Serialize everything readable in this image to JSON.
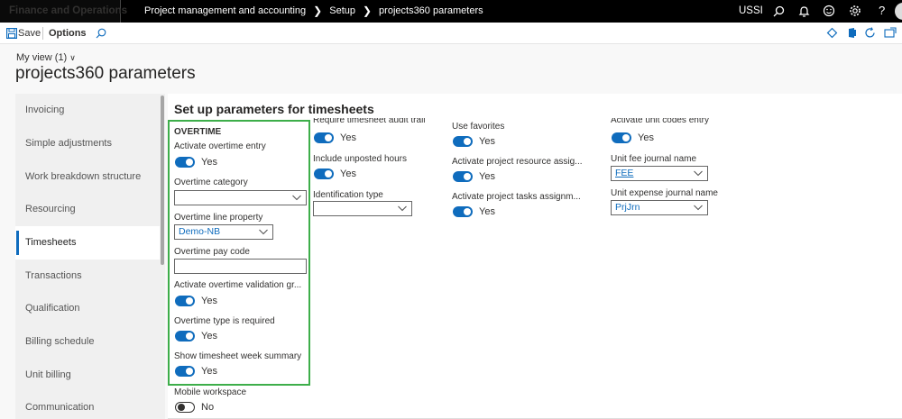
{
  "topnav": {
    "app_title": "Finance and Operations",
    "breadcrumb": [
      "Project management and accounting",
      "Setup",
      "projects360 parameters"
    ],
    "company": "USSI"
  },
  "actionbar": {
    "save_label": "Save",
    "options_label": "Options"
  },
  "header": {
    "my_view": "My view (1)",
    "page_title": "projects360 parameters"
  },
  "sidebar": {
    "items": [
      {
        "label": "Invoicing"
      },
      {
        "label": "Simple adjustments"
      },
      {
        "label": "Work breakdown structure"
      },
      {
        "label": "Resourcing"
      },
      {
        "label": "Timesheets"
      },
      {
        "label": "Transactions"
      },
      {
        "label": "Qualification"
      },
      {
        "label": "Billing schedule"
      },
      {
        "label": "Unit billing"
      },
      {
        "label": "Communication"
      }
    ],
    "active": "Timesheets"
  },
  "main": {
    "section_title": "Set up parameters for timesheets",
    "overtime": {
      "group_label": "OVERTIME",
      "activate_overtime_entry": {
        "label": "Activate overtime entry",
        "value": "Yes"
      },
      "overtime_category": {
        "label": "Overtime category",
        "value": ""
      },
      "overtime_line_property": {
        "label": "Overtime line property",
        "value": "Demo-NB"
      },
      "overtime_pay_code": {
        "label": "Overtime pay code",
        "value": ""
      },
      "activate_validation_group": {
        "label": "Activate overtime validation gr...",
        "value": "Yes"
      },
      "overtime_type_required": {
        "label": "Overtime type is required",
        "value": "Yes"
      },
      "show_week_summary": {
        "label": "Show timesheet week summary",
        "value": "Yes"
      }
    },
    "mobile_workspace": {
      "label": "Mobile workspace",
      "value": "No"
    },
    "col2": {
      "require_audit_trail": {
        "label": "Require timesheet audit trail",
        "value": "Yes"
      },
      "include_unposted_hours": {
        "label": "Include unposted hours",
        "value": "Yes"
      },
      "identification_type": {
        "label": "Identification type",
        "value": ""
      }
    },
    "col3": {
      "use_favorites": {
        "label": "Use favorites",
        "value": "Yes"
      },
      "activate_resource_assignment": {
        "label": "Activate project resource assig...",
        "value": "Yes"
      },
      "activate_tasks_assignment": {
        "label": "Activate project tasks assignm...",
        "value": "Yes"
      }
    },
    "col4": {
      "activate_unit_codes": {
        "label": "Activate unit codes entry",
        "value": "Yes"
      },
      "unit_fee_journal": {
        "label": "Unit fee journal name",
        "value": "FEE"
      },
      "unit_expense_journal": {
        "label": "Unit expense journal name",
        "value": "PrjJrn"
      }
    }
  },
  "colors": {
    "accent": "#0f6cbd",
    "highlight_border": "#3dae4a",
    "topnav_bg": "#000000"
  }
}
